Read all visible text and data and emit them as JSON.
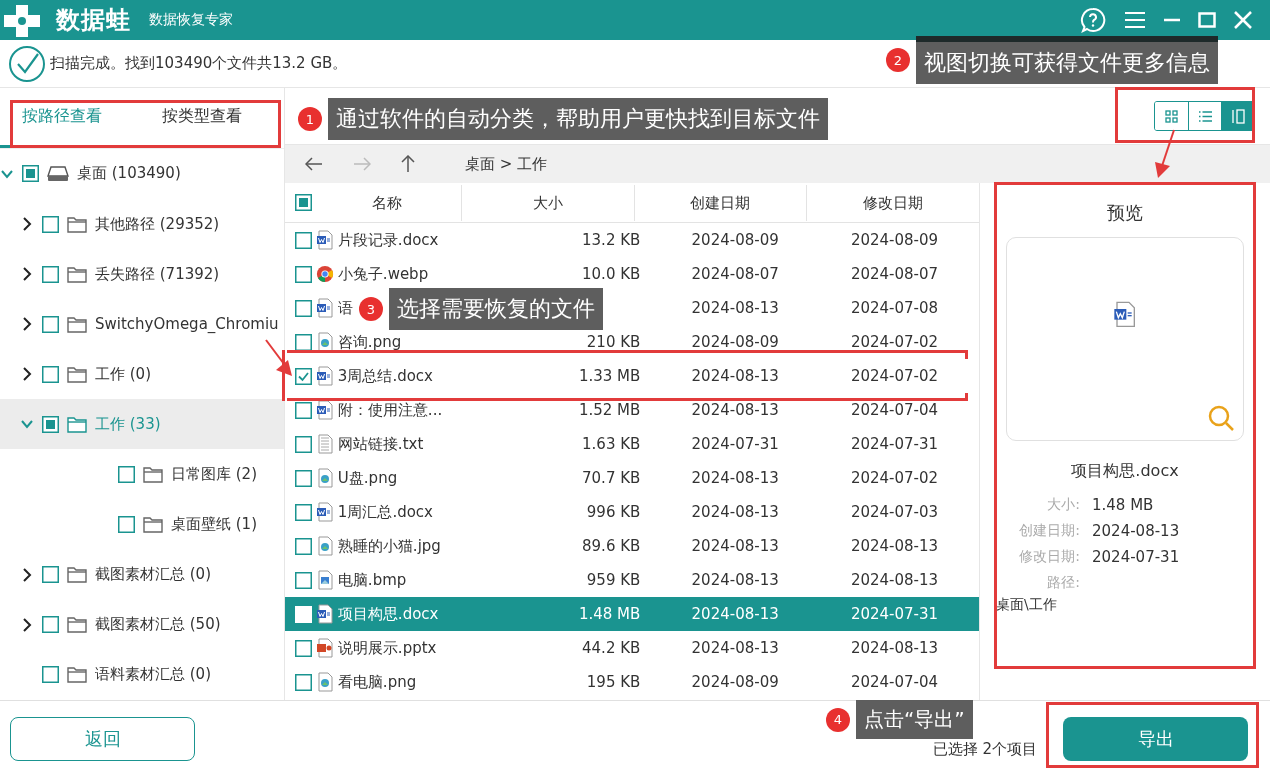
{
  "app": {
    "logo": "数据蛙",
    "subtitle": "数据恢复专家"
  },
  "status": "扫描完成。找到103490个文件共13.2 GB。",
  "view_tabs": [
    {
      "label": "按路径查看",
      "selected": true
    },
    {
      "label": "按类型查看",
      "selected": false
    }
  ],
  "tree": [
    {
      "label": "桌面 (103490)",
      "kind": "drive",
      "checked": false,
      "partial": true,
      "expandable": true,
      "expanded": true,
      "selected": false,
      "children": [
        {
          "label": "其他路径 (29352)",
          "kind": "folder",
          "checked": false,
          "partial": false,
          "expandable": true,
          "expanded": false,
          "selected": false
        },
        {
          "label": "丢失路径 (71392)",
          "kind": "folder",
          "checked": false,
          "partial": false,
          "expandable": true,
          "expanded": false,
          "selected": false
        },
        {
          "label": "SwitchyOmega_Chromiu",
          "kind": "folder",
          "checked": false,
          "partial": false,
          "expandable": true,
          "expanded": false,
          "selected": false
        },
        {
          "label": "工作 (0)",
          "kind": "folder",
          "checked": false,
          "partial": false,
          "expandable": true,
          "expanded": false,
          "selected": false
        },
        {
          "label": "工作 (33)",
          "kind": "folder",
          "checked": false,
          "partial": true,
          "expandable": true,
          "expanded": true,
          "selected": true,
          "children": [
            {
              "label": "日常图库 (2)",
              "kind": "folder",
              "checked": false,
              "partial": false,
              "expandable": false,
              "selected": false
            },
            {
              "label": "桌面壁纸 (1)",
              "kind": "folder",
              "checked": false,
              "partial": false,
              "expandable": false,
              "selected": false
            }
          ]
        },
        {
          "label": "截图素材汇总 (0)",
          "kind": "folder",
          "checked": false,
          "partial": false,
          "expandable": true,
          "expanded": false,
          "selected": false
        },
        {
          "label": "截图素材汇总 (50)",
          "kind": "folder",
          "checked": false,
          "partial": false,
          "expandable": true,
          "expanded": false,
          "selected": false
        },
        {
          "label": "语料素材汇总 (0)",
          "kind": "folder",
          "checked": false,
          "partial": false,
          "expandable": false,
          "selected": false
        }
      ]
    }
  ],
  "view_modes": [
    {
      "kind": "grid",
      "selected": false
    },
    {
      "kind": "list",
      "selected": false
    },
    {
      "kind": "preview",
      "selected": true
    }
  ],
  "breadcrumb": "桌面 > 工作",
  "table": {
    "header_checkbox": {
      "checked": false,
      "partial": true
    },
    "columns": [
      "名称",
      "大小",
      "创建日期",
      "修改日期"
    ],
    "rows": [
      {
        "kind": "word",
        "name": "片段记录.docx",
        "size": "13.2 KB",
        "created": "2024-08-09",
        "modified": "2024-08-09",
        "checked": false,
        "selected": false
      },
      {
        "kind": "browser",
        "name": "小兔子.webp",
        "size": "10.0 KB",
        "created": "2024-08-07",
        "modified": "2024-08-07",
        "checked": false,
        "selected": false
      },
      {
        "kind": "word",
        "name": "语",
        "created": "2024-08-13",
        "modified": "2024-07-08",
        "checked": false,
        "selected": false
      },
      {
        "kind": "image",
        "name": "咨询.png",
        "size": "210 KB",
        "created": "2024-08-09",
        "modified": "2024-07-02",
        "checked": false,
        "selected": false
      },
      {
        "kind": "word",
        "name": "3周总结.docx",
        "size": "1.33 MB",
        "created": "2024-08-13",
        "modified": "2024-07-02",
        "checked": true,
        "selected": false
      },
      {
        "kind": "word",
        "name": "附：使用注意...",
        "size": "1.52 MB",
        "created": "2024-08-13",
        "modified": "2024-07-04",
        "checked": false,
        "selected": false
      },
      {
        "kind": "text",
        "name": "网站链接.txt",
        "size": "1.63 KB",
        "created": "2024-07-31",
        "modified": "2024-07-31",
        "checked": false,
        "selected": false
      },
      {
        "kind": "image",
        "name": "U盘.png",
        "size": "70.7 KB",
        "created": "2024-08-13",
        "modified": "2024-07-02",
        "checked": false,
        "selected": false
      },
      {
        "kind": "word",
        "name": "1周汇总.docx",
        "size": "996 KB",
        "created": "2024-08-13",
        "modified": "2024-07-03",
        "checked": false,
        "selected": false
      },
      {
        "kind": "image",
        "name": "熟睡的小猫.jpg",
        "size": "89.6 KB",
        "created": "2024-08-13",
        "modified": "2024-08-13",
        "checked": false,
        "selected": false
      },
      {
        "kind": "bitmap",
        "name": "电脑.bmp",
        "size": "959 KB",
        "created": "2024-08-13",
        "modified": "2024-08-13",
        "checked": false,
        "selected": false
      },
      {
        "kind": "word",
        "name": "项目构思.docx",
        "size": "1.48 MB",
        "created": "2024-08-13",
        "modified": "2024-07-31",
        "checked": false,
        "selected": true
      },
      {
        "kind": "slides",
        "name": "说明展示.pptx",
        "size": "44.2 KB",
        "created": "2024-08-13",
        "modified": "2024-08-13",
        "checked": false,
        "selected": false
      },
      {
        "kind": "image",
        "name": "看电脑.png",
        "size": "195 KB",
        "created": "2024-08-09",
        "modified": "2024-07-04",
        "checked": false,
        "selected": false
      }
    ]
  },
  "preview": {
    "title": "预览",
    "file_name": "项目构思.docx",
    "fields": [
      {
        "label": "大小:",
        "value": "1.48 MB"
      },
      {
        "label": "创建日期:",
        "value": "2024-08-13"
      },
      {
        "label": "修改日期:",
        "value": "2024-07-31"
      },
      {
        "label": "路径:"
      }
    ],
    "path": "桌面\\工作"
  },
  "footer": {
    "back_button": "返回",
    "selection": "已选择 2个项目",
    "export_button": "导出"
  },
  "callouts": [
    {
      "number": "1",
      "text": "通过软件的自动分类，帮助用户更快找到目标文件"
    },
    {
      "number": "2",
      "text": "视图切换可获得文件更多信息"
    },
    {
      "number": "3",
      "text": "选择需要恢复的文件"
    },
    {
      "number": "4",
      "text": "点击“导出”"
    }
  ]
}
